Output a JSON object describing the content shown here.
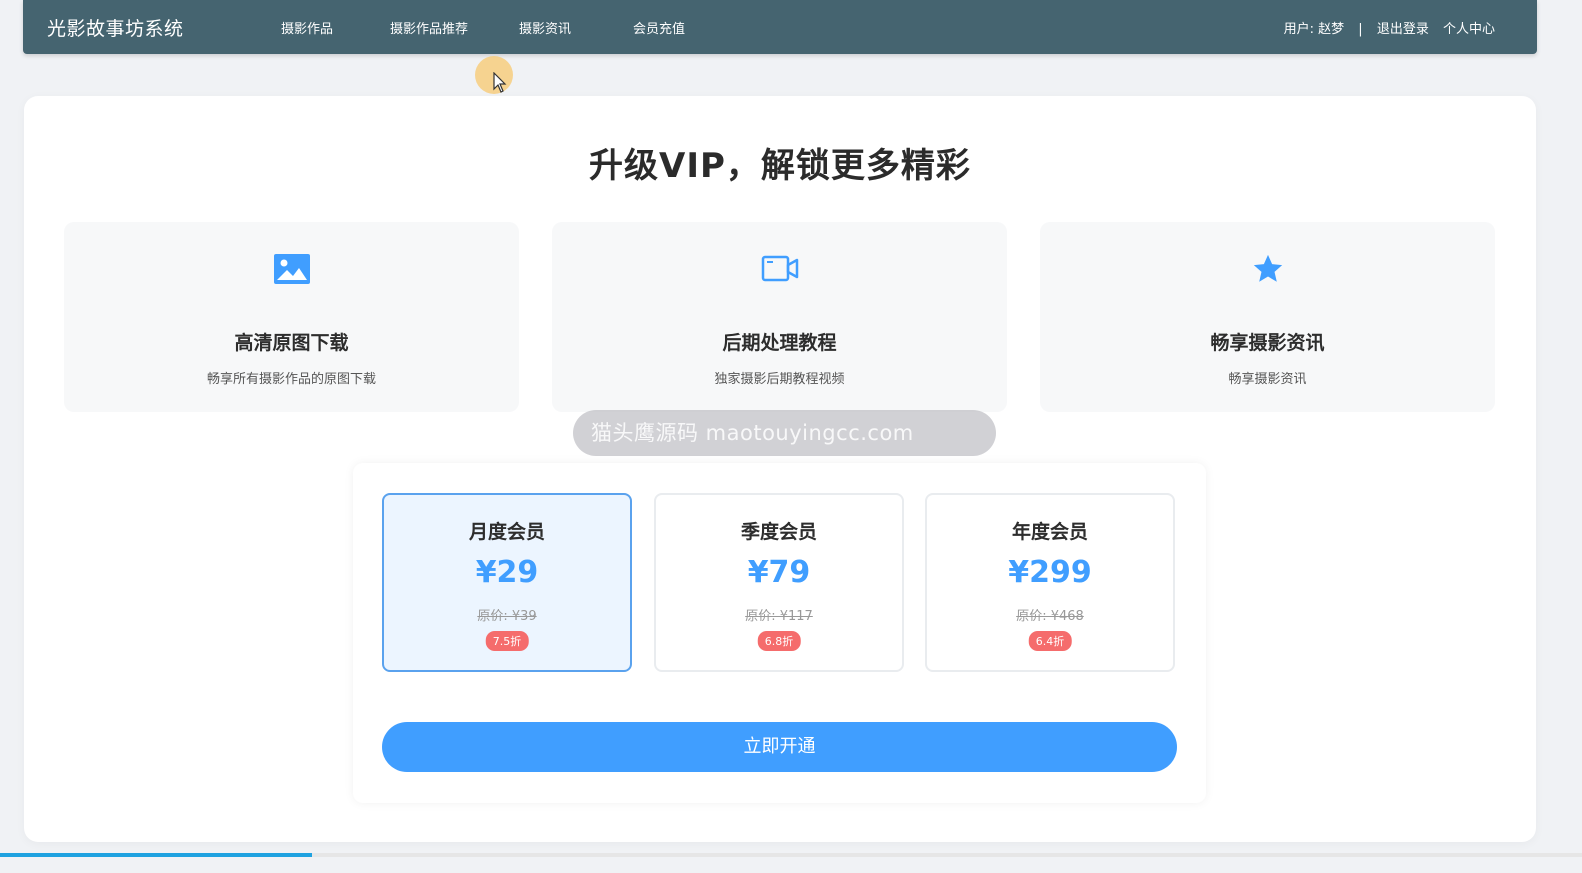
{
  "header": {
    "brand": "光影故事坊系统",
    "nav": [
      "摄影作品",
      "摄影作品推荐",
      "摄影资讯",
      "会员充值"
    ],
    "user_prefix": "用户:",
    "username": "赵梦",
    "separator": "|",
    "logout": "退出登录",
    "profile": "个人中心"
  },
  "main": {
    "headline": "升级VIP，解锁更多精彩",
    "features": [
      {
        "icon": "image-icon",
        "title": "高清原图下载",
        "desc": "畅享所有摄影作品的原图下载"
      },
      {
        "icon": "video-icon",
        "title": "后期处理教程",
        "desc": "独家摄影后期教程视频"
      },
      {
        "icon": "star-icon",
        "title": "畅享摄影资讯",
        "desc": "畅享摄影资讯"
      }
    ],
    "plans": [
      {
        "name": "月度会员",
        "price": "¥29",
        "original": "原价: ¥39",
        "discount": "7.5折",
        "selected": true
      },
      {
        "name": "季度会员",
        "price": "¥79",
        "original": "原价: ¥117",
        "discount": "6.8折",
        "selected": false
      },
      {
        "name": "年度会员",
        "price": "¥299",
        "original": "原价: ¥468",
        "discount": "6.4折",
        "selected": false
      }
    ],
    "buy_label": "立即开通"
  },
  "watermark": "猫头鹰源码 maotouyingcc.com",
  "page_progress": 0.197,
  "colors": {
    "header_bg": "#456470",
    "accent": "#409eff",
    "discount_badge": "#f56c6c",
    "selected_plan_bg": "#ecf5ff"
  }
}
